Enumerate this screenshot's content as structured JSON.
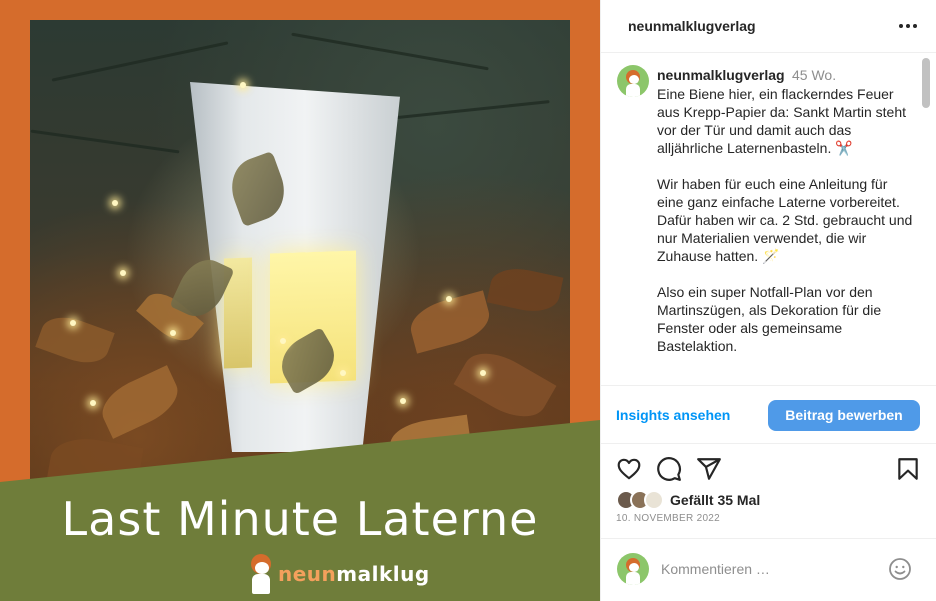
{
  "post_image": {
    "title": "Last Minute Laterne",
    "brand_text_part1": "neun",
    "brand_text_part2": "malklug",
    "colors": {
      "border": "#d56c2c",
      "banner": "#6f7d3a"
    }
  },
  "header": {
    "username": "neunmalklugverlag",
    "more_icon": "more-options-icon"
  },
  "caption": {
    "username": "neunmalklugverlag",
    "time": "45 Wo.",
    "paragraphs": [
      "Eine Biene hier, ein flackerndes Feuer aus Krepp-Papier da: Sankt Martin steht vor der Tür und damit auch das alljährliche Laternenbasteln. ✂️",
      "Wir haben für euch eine Anleitung für eine ganz einfache Laterne vorbereitet. Dafür haben wir ca. 2 Std. gebraucht und nur Materialien verwendet, die wir Zuhause hatten. 🪄",
      "Also ein super Notfall-Plan vor den Martinszügen, als Dekoration für die Fenster oder als gemeinsame Bastelaktion."
    ]
  },
  "promo": {
    "insights_label": "Insights ansehen",
    "promote_label": "Beitrag bewerben",
    "accent": "#0095f6"
  },
  "actions": {
    "icons": [
      "heart-icon",
      "comment-icon",
      "share-icon",
      "bookmark-icon"
    ]
  },
  "likes": {
    "text": "Gefällt 35 Mal"
  },
  "date": "10. NOVEMBER 2022",
  "comment": {
    "placeholder": "Kommentieren …",
    "emoji_icon": "emoji-icon"
  }
}
